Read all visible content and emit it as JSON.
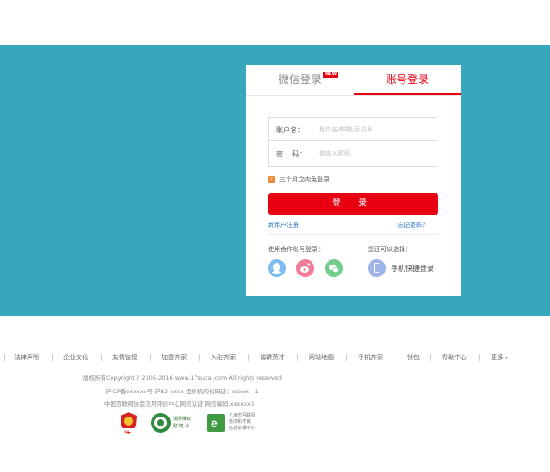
{
  "login": {
    "tabs": [
      {
        "label": "微信登录",
        "badge": "NEW"
      },
      {
        "label": "账号登录"
      }
    ],
    "username": {
      "label": "账户名：",
      "placeholder": "用户名/邮箱/手机号"
    },
    "password": {
      "label": "密    码：",
      "placeholder": "请输入密码"
    },
    "remember_label": "三个月之内免登录",
    "remember_checked": true,
    "login_button": "登 录",
    "register_link": "新用户注册",
    "forgot_link": "忘记密码？",
    "partner_title": "使用合作账号登录：",
    "partners": [
      "qq-icon",
      "weibo-icon",
      "wechat-icon"
    ],
    "alt_title": "您还可以选择：",
    "phone_login": "手机快捷登录"
  },
  "footer": {
    "nav": [
      "法律声明",
      "企业文化",
      "友情链接",
      "加盟齐家",
      "入驻齐家",
      "诚聘英才",
      "网站地图",
      "手机齐家",
      "钱包",
      "帮助中心",
      "更多"
    ],
    "copyright": "版权所有Copyright ? 2005-2016 www.17sucai.com All rights reserved",
    "icp": "沪ICP备xxxxxx号 沪B2-xxxx 组织机构代码证：xxxxx—1",
    "credit": "中国互联网协会信用评价中心网信认证 网信编码:xxxxxx1",
    "badges": {
      "police": "网警",
      "consumer": [
        "消费维权",
        "联 络 点"
      ],
      "shanghai": [
        "上海市互联网",
        "违法和不良",
        "信息举报中心"
      ]
    }
  },
  "colors": {
    "banner": "#35a8bb",
    "accent": "#e60012",
    "link": "#2a74c8"
  }
}
